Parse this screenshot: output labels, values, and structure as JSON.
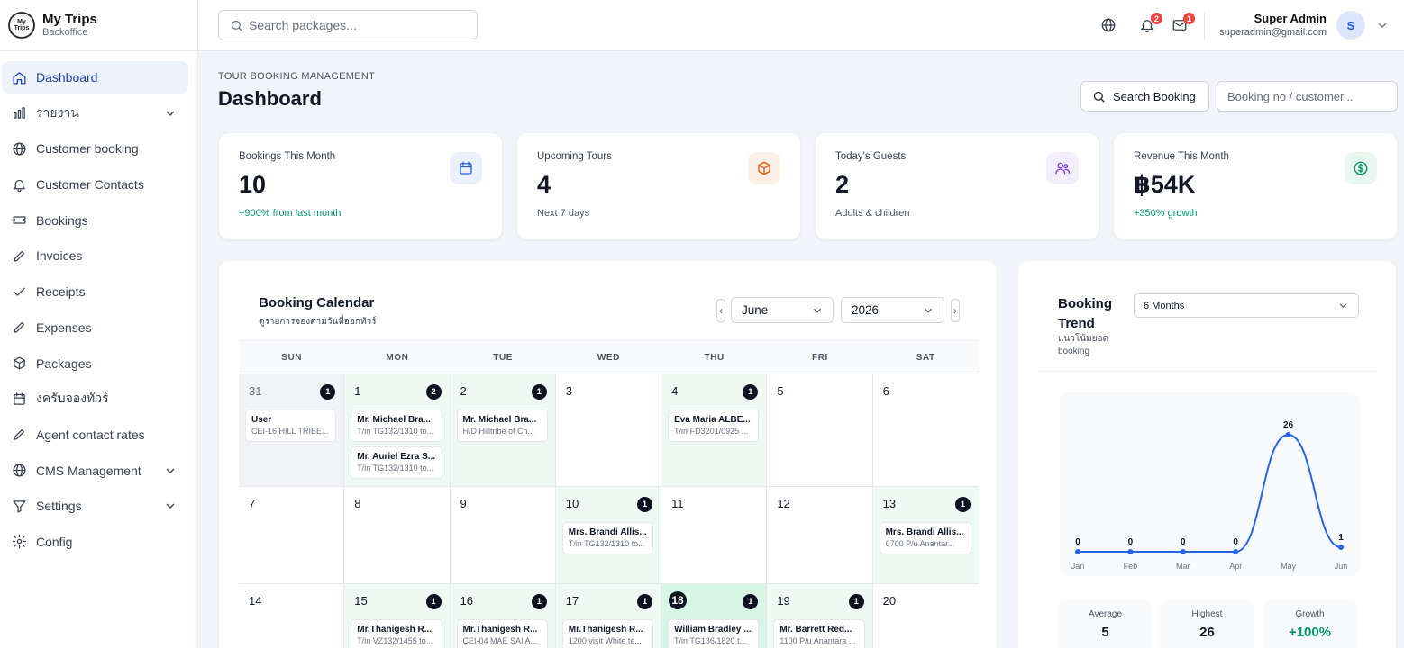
{
  "brand": {
    "name": "My Trips",
    "subtitle": "Backoffice",
    "logo_text": "My Trips"
  },
  "sidebar": {
    "items": [
      {
        "label": "Dashboard",
        "icon": "home-icon",
        "active": true,
        "expandable": false
      },
      {
        "label": "รายงาน",
        "icon": "bar-chart-icon",
        "active": false,
        "expandable": true
      },
      {
        "label": "Customer booking",
        "icon": "globe-icon",
        "active": false,
        "expandable": false
      },
      {
        "label": "Customer Contacts",
        "icon": "bell-icon",
        "active": false,
        "expandable": false
      },
      {
        "label": "Bookings",
        "icon": "ticket-icon",
        "active": false,
        "expandable": false
      },
      {
        "label": "Invoices",
        "icon": "pencil-icon",
        "active": false,
        "expandable": false
      },
      {
        "label": "Receipts",
        "icon": "check-icon",
        "active": false,
        "expandable": false
      },
      {
        "label": "Expenses",
        "icon": "pencil-icon",
        "active": false,
        "expandable": false
      },
      {
        "label": "Packages",
        "icon": "package-icon",
        "active": false,
        "expandable": false
      },
      {
        "label": "งครับจองทัวร์",
        "icon": "calendar-icon",
        "active": false,
        "expandable": false
      },
      {
        "label": "Agent contact rates",
        "icon": "pencil-icon",
        "active": false,
        "expandable": false
      },
      {
        "label": "CMS Management",
        "icon": "globe-icon",
        "active": false,
        "expandable": true
      },
      {
        "label": "Settings",
        "icon": "filter-icon",
        "active": false,
        "expandable": true
      },
      {
        "label": "Config",
        "icon": "gear-icon",
        "active": false,
        "expandable": false
      }
    ]
  },
  "topbar": {
    "search_placeholder": "Search packages...",
    "notifications_count": "2",
    "messages_count": "1",
    "user_name": "Super Admin",
    "user_email": "superadmin@gmail.com",
    "avatar_initial": "S"
  },
  "header": {
    "eyebrow": "TOUR BOOKING MANAGEMENT",
    "title": "Dashboard",
    "search_button": "Search Booking",
    "booking_placeholder": "Booking no / customer..."
  },
  "stats": [
    {
      "label": "Bookings This Month",
      "value": "10",
      "sub": "+900% from last month",
      "sub_green": true,
      "icon": "calendar-icon",
      "icon_bg": "#eaf1fd",
      "icon_color": "#2563eb"
    },
    {
      "label": "Upcoming Tours",
      "value": "4",
      "sub": "Next 7 days",
      "sub_green": false,
      "icon": "package-icon",
      "icon_bg": "#fdf1e7",
      "icon_color": "#ea580c"
    },
    {
      "label": "Today's Guests",
      "value": "2",
      "sub": "Adults & children",
      "sub_green": false,
      "icon": "users-icon",
      "icon_bg": "#f3eefc",
      "icon_color": "#7c3aed"
    },
    {
      "label": "Revenue This Month",
      "value": "฿54K",
      "sub": "+350% growth",
      "sub_green": true,
      "icon": "dollar-icon",
      "icon_bg": "#e8f7ef",
      "icon_color": "#059669"
    }
  ],
  "calendar": {
    "title": "Booking Calendar",
    "subtitle": "ดูรายการจองตามวันที่ออกทัวร์",
    "prev": "‹",
    "next": "›",
    "month": "June",
    "year": "2026",
    "weekdays": [
      "SUN",
      "MON",
      "TUE",
      "WED",
      "THU",
      "FRI",
      "SAT"
    ],
    "weeks": [
      [
        {
          "day": "31",
          "other": true,
          "count": "1",
          "events": [
            {
              "name": "User",
              "detail": "CEI-16 HILL TRIBE..."
            }
          ]
        },
        {
          "day": "1",
          "count": "2",
          "events": [
            {
              "name": "Mr. Michael Bra...",
              "detail": "T/in TG132/1310 to..."
            },
            {
              "name": "Mr. Auriel Ezra S...",
              "detail": "T/in TG132/1310 to..."
            }
          ]
        },
        {
          "day": "2",
          "count": "1",
          "events": [
            {
              "name": "Mr. Michael Bra...",
              "detail": "H/D Hilltribe of Ch..."
            }
          ]
        },
        {
          "day": "3",
          "count": "",
          "events": []
        },
        {
          "day": "4",
          "count": "1",
          "events": [
            {
              "name": "Eva Maria ALBE...",
              "detail": "T/in FD3201/0925 ..."
            }
          ]
        },
        {
          "day": "5",
          "count": "",
          "events": []
        },
        {
          "day": "6",
          "count": "",
          "events": []
        }
      ],
      [
        {
          "day": "7",
          "count": "",
          "events": []
        },
        {
          "day": "8",
          "count": "",
          "events": []
        },
        {
          "day": "9",
          "count": "",
          "events": []
        },
        {
          "day": "10",
          "count": "1",
          "events": [
            {
              "name": "Mrs. Brandi Allis...",
              "detail": "T/in TG132/1310 to..."
            }
          ]
        },
        {
          "day": "11",
          "count": "",
          "events": []
        },
        {
          "day": "12",
          "count": "",
          "events": []
        },
        {
          "day": "13",
          "count": "1",
          "events": [
            {
              "name": "Mrs. Brandi Allis...",
              "detail": "0700 P/u Anantar..."
            }
          ]
        }
      ],
      [
        {
          "day": "14",
          "count": "",
          "events": []
        },
        {
          "day": "15",
          "count": "1",
          "events": [
            {
              "name": "Mr.Thanigesh R...",
              "detail": "T/in VZ132/1455 to..."
            }
          ]
        },
        {
          "day": "16",
          "count": "1",
          "events": [
            {
              "name": "Mr.Thanigesh R...",
              "detail": "CEI-04 MAE SAI A..."
            }
          ]
        },
        {
          "day": "17",
          "count": "1",
          "events": [
            {
              "name": "Mr.Thanigesh R...",
              "detail": "1200 visit White te..."
            }
          ]
        },
        {
          "day": "18",
          "today": true,
          "count": "1",
          "events": [
            {
              "name": "William Bradley ...",
              "detail": "T/in TG136/1820 t..."
            }
          ]
        },
        {
          "day": "19",
          "count": "1",
          "events": [
            {
              "name": "Mr. Barrett Red...",
              "detail": "1100 P/u Anantara ..."
            }
          ]
        },
        {
          "day": "20",
          "count": "",
          "events": []
        }
      ]
    ]
  },
  "trend": {
    "title": "Booking Trend",
    "subtitle": "แนวโน้มยอด booking",
    "range": "6 Months",
    "stats": [
      {
        "label": "Average",
        "value": "5",
        "green": false
      },
      {
        "label": "Highest",
        "value": "26",
        "green": false
      },
      {
        "label": "Growth",
        "value": "+100%",
        "green": true
      }
    ]
  },
  "chart_data": {
    "type": "line",
    "categories": [
      "Jan",
      "Feb",
      "Mar",
      "Apr",
      "May",
      "Jun"
    ],
    "values": [
      0,
      0,
      0,
      0,
      26,
      1
    ],
    "ylim": [
      0,
      26
    ],
    "grid": false,
    "line_color": "#2563eb"
  }
}
